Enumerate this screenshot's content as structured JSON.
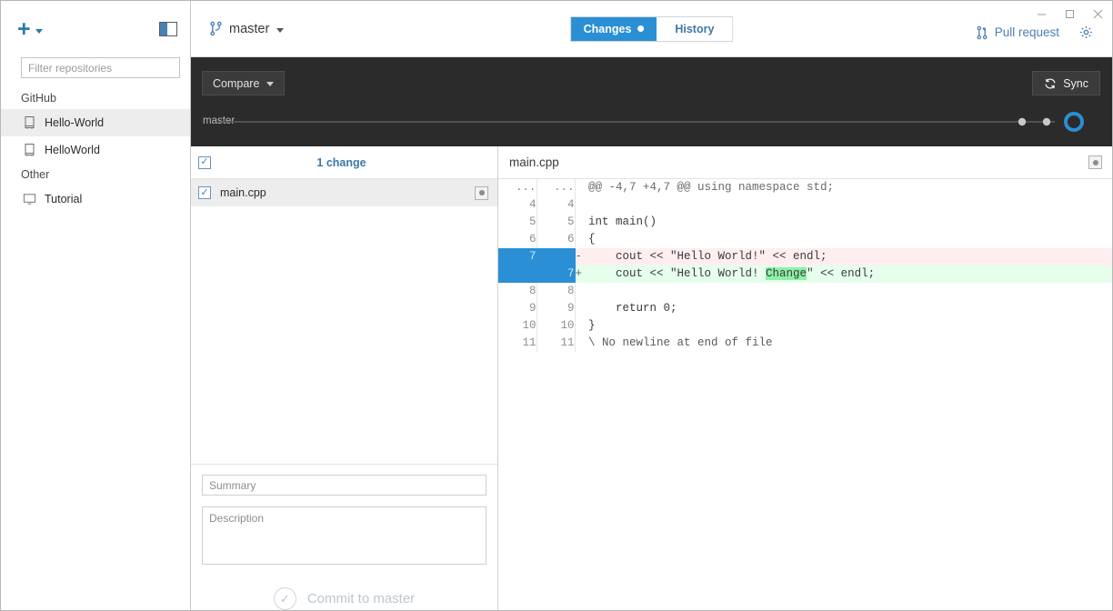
{
  "window": {
    "controls": [
      {
        "name": "minimize",
        "glyph": "minimize-icon"
      },
      {
        "name": "maximize",
        "glyph": "maximize-icon"
      },
      {
        "name": "close",
        "glyph": "close-icon"
      }
    ]
  },
  "sidebar": {
    "add_button_label": "+",
    "panel_toggle_name": "panel-toggle-icon",
    "filter": {
      "value": "",
      "placeholder": "Filter repositories"
    },
    "groups": [
      {
        "label": "GitHub",
        "items": [
          {
            "label": "Hello-World",
            "icon": "repo-icon",
            "selected": true
          },
          {
            "label": "HelloWorld",
            "icon": "repo-icon",
            "selected": false
          }
        ]
      },
      {
        "label": "Other",
        "items": [
          {
            "label": "Tutorial",
            "icon": "monitor-icon",
            "selected": false
          }
        ]
      }
    ]
  },
  "toolbar": {
    "branch_icon": "git-branch-icon",
    "branch_name": "master",
    "tabs": [
      {
        "label": "Changes",
        "selected": true,
        "has_dot": true
      },
      {
        "label": "History",
        "selected": false,
        "has_dot": false
      }
    ],
    "pull_request_label": "Pull request",
    "pull_request_icon": "git-pull-request-icon",
    "settings_icon": "gear-icon"
  },
  "compare_bar": {
    "compare_label": "Compare",
    "sync_label": "Sync",
    "sync_icon": "sync-icon",
    "branch_label": "master",
    "timeline": {
      "commit_dots": 2,
      "head_marker": "current-commit-ring"
    }
  },
  "changes_panel": {
    "select_all_checked": true,
    "header_title": "1 change",
    "files": [
      {
        "name": "main.cpp",
        "checked": true,
        "action_icon": "file-options-icon"
      }
    ],
    "summary": {
      "value": "",
      "placeholder": "Summary"
    },
    "description": {
      "value": "",
      "placeholder": "Description"
    },
    "commit_button": {
      "label": "Commit to master",
      "enabled": false,
      "icon": "check-circle-icon"
    }
  },
  "diff_panel": {
    "file_name": "main.cpp",
    "options_icon": "diff-options-icon",
    "rows": [
      {
        "type": "hunk",
        "old": "...",
        "new": "...",
        "mark": "",
        "code": "@@ -4,7 +4,7 @@ using namespace std;",
        "selected": false
      },
      {
        "type": "ctx",
        "old": "4",
        "new": "4",
        "mark": "",
        "code": "",
        "selected": false
      },
      {
        "type": "ctx",
        "old": "5",
        "new": "5",
        "mark": "",
        "code": "int main()",
        "selected": false
      },
      {
        "type": "ctx",
        "old": "6",
        "new": "6",
        "mark": "",
        "code": "{",
        "selected": false
      },
      {
        "type": "del",
        "old": "7",
        "new": "",
        "mark": "-",
        "code": "    cout << \"Hello World!\" << endl;",
        "selected": true
      },
      {
        "type": "add",
        "old": "",
        "new": "7",
        "mark": "+",
        "code_pre": "    cout << \"Hello World! ",
        "code_hl": "Change",
        "code_post": "\" << endl;",
        "selected": true
      },
      {
        "type": "ctx",
        "old": "8",
        "new": "8",
        "mark": "",
        "code": "",
        "selected": false
      },
      {
        "type": "ctx",
        "old": "9",
        "new": "9",
        "mark": "",
        "code": "    return 0;",
        "selected": false
      },
      {
        "type": "ctx",
        "old": "10",
        "new": "10",
        "mark": "",
        "code": "}",
        "selected": false
      },
      {
        "type": "meta",
        "old": "11",
        "new": "11",
        "mark": "",
        "code": "\\ No newline at end of file",
        "selected": false
      }
    ]
  },
  "colors": {
    "accent_blue": "#2a8fd4",
    "link_blue": "#3d78a8",
    "dark_band": "#2b2b2b",
    "add_bg": "#e6ffec",
    "del_bg": "#ffeef0",
    "word_highlight": "#8ef0a6"
  }
}
